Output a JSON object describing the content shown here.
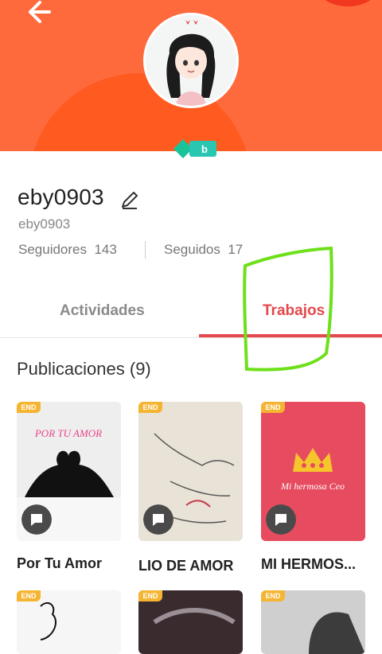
{
  "profile": {
    "username": "eby0903",
    "handle": "eby0903",
    "followers_label": "Seguidores",
    "followers_count": "143",
    "following_label": "Seguidos",
    "following_count": "17",
    "badge_letter": "b"
  },
  "tabs": [
    {
      "label": "Actividades",
      "active": false
    },
    {
      "label": "Trabajos",
      "active": true
    }
  ],
  "section": {
    "title": "Publicaciones (9)"
  },
  "works": [
    {
      "title": "Por Tu Amor",
      "badge": "END",
      "cover_text": "POR TU AMOR"
    },
    {
      "title": "LIO DE AMOR",
      "badge": "END"
    },
    {
      "title": "MI HERMOS...",
      "badge": "END",
      "cover_text": "Mi hermosa Ceo"
    },
    {
      "badge": "END"
    },
    {
      "badge": "END"
    },
    {
      "badge": "END"
    }
  ],
  "colors": {
    "header": "#ff6a3d",
    "active_tab": "#e5484d",
    "end_badge": "#f5b431",
    "annotation": "#6ee01a"
  }
}
